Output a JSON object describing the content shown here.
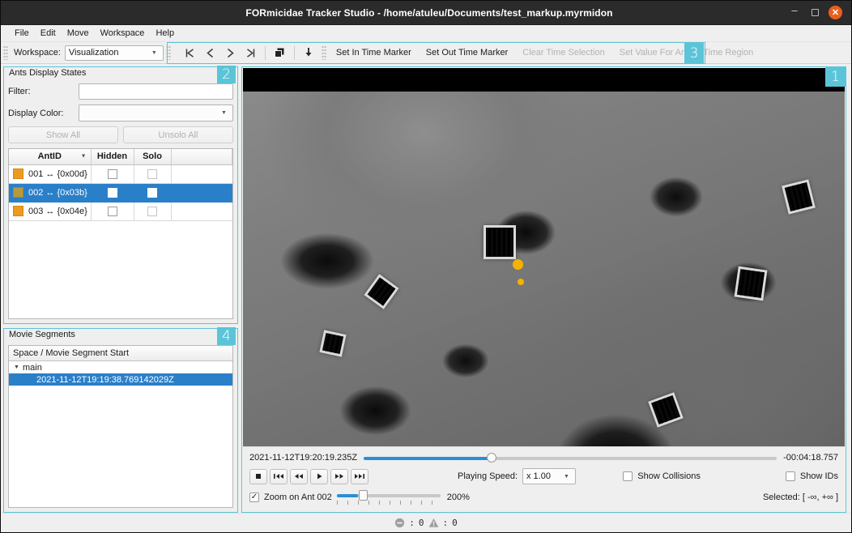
{
  "window": {
    "title": "FORmicidae Tracker Studio - /home/atuleu/Documents/test_markup.myrmidon",
    "minimize_label": "–",
    "maximize_label": "",
    "close_label": "✕"
  },
  "menubar": {
    "items": [
      "File",
      "Edit",
      "Move",
      "Workspace",
      "Help"
    ]
  },
  "toolbar": {
    "workspace_label": "Workspace:",
    "workspace_value": "Visualization",
    "nav_buttons": [
      {
        "name": "jump-to-start-button",
        "glyph": "skip-start"
      },
      {
        "name": "previous-button",
        "glyph": "prev"
      },
      {
        "name": "next-button",
        "glyph": "next"
      },
      {
        "name": "jump-to-end-button",
        "glyph": "skip-end"
      }
    ],
    "copy_button_name": "duplicate-icon",
    "download_button_name": "download-icon",
    "actions": [
      {
        "label": "Set In Time Marker",
        "enabled": true
      },
      {
        "label": "Set Out Time Marker",
        "enabled": true
      },
      {
        "label": "Clear Time Selection",
        "enabled": false
      },
      {
        "label": "Set Value For Ant on Time Region",
        "enabled": false
      }
    ],
    "badge": "3"
  },
  "ants_panel": {
    "title": "Ants Display States",
    "badge": "2",
    "filter_label": "Filter:",
    "filter_value": "",
    "filter_placeholder": "",
    "display_color_label": "Display Color:",
    "display_color_value": "",
    "show_all_label": "Show All",
    "unsolo_all_label": "Unsolo All",
    "columns": [
      "AntID",
      "Hidden",
      "Solo"
    ],
    "rows": [
      {
        "color": "#ED9B1E",
        "antid": "001 ↔ {0x00d}",
        "hidden": false,
        "solo": false,
        "selected": false
      },
      {
        "color": "#B79A3E",
        "antid": "002 ↔ {0x03b}",
        "hidden": false,
        "solo": false,
        "selected": true
      },
      {
        "color": "#ED9B1E",
        "antid": "003 ↔ {0x04e}",
        "hidden": false,
        "solo": false,
        "selected": false
      }
    ]
  },
  "movie_panel": {
    "title": "Movie Segments",
    "badge": "4",
    "column_header": "Space / Movie Segment Start",
    "tree": {
      "root_label": "main",
      "child_label": "2021-11-12T19:19:38.769142029Z"
    }
  },
  "video": {
    "badge": "1",
    "overlay_timestamp": "2021-11-12T19:20:19.235Z"
  },
  "controls": {
    "current_time": "2021-11-12T19:20:19.235Z",
    "remaining_time": "-00:04:18.757",
    "timeline_percent": 31,
    "playback_buttons": [
      {
        "name": "stop-button",
        "glyph": "stop"
      },
      {
        "name": "skip-backward-button",
        "glyph": "skip-back"
      },
      {
        "name": "rewind-button",
        "glyph": "rewind"
      },
      {
        "name": "play-button",
        "glyph": "play"
      },
      {
        "name": "fast-forward-button",
        "glyph": "forward"
      },
      {
        "name": "skip-forward-button",
        "glyph": "skip-fwd"
      }
    ],
    "playing_speed_label": "Playing Speed:",
    "playing_speed_value": "x 1.00",
    "show_collisions_label": "Show Collisions",
    "show_collisions_checked": false,
    "show_ids_label": "Show IDs",
    "show_ids_checked": false,
    "zoom_on_ant_label": "Zoom on Ant 002",
    "zoom_on_ant_checked": true,
    "zoom_check_glyph": "✓",
    "zoom_value": "200%",
    "selected_label": "Selected: [ -∞, +∞ ]"
  },
  "statusbar": {
    "error_icon_name": "error-icon",
    "error_count": "0",
    "warning_icon_name": "warning-icon",
    "warning_count": "0",
    "separator": ":"
  },
  "colors": {
    "accent_teal": "#5bc4d8",
    "selection_blue": "#2a7fc9",
    "slider_blue": "#2a8fd4",
    "titlebar": "#2b2b2b",
    "close_orange": "#e8601c"
  }
}
